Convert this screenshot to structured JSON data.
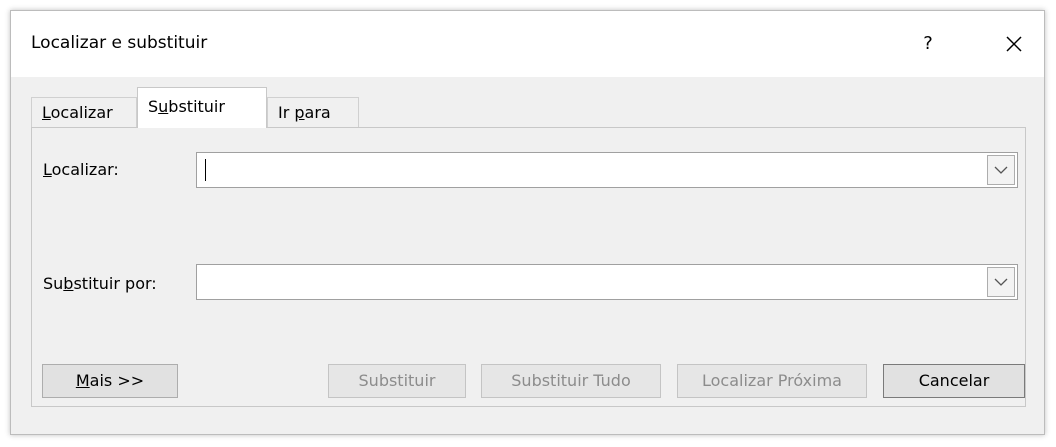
{
  "window": {
    "title": "Localizar e substituir",
    "help_label": "?",
    "close_icon": "close-icon"
  },
  "tabs": [
    {
      "pre": "",
      "ul": "L",
      "post": "ocalizar",
      "active": false
    },
    {
      "pre": "S",
      "ul": "u",
      "post": "bstituir",
      "active": true
    },
    {
      "pre": "Ir ",
      "ul": "p",
      "post": "ara",
      "active": false
    }
  ],
  "fields": {
    "find": {
      "label_ul": "L",
      "label_post": "ocalizar:",
      "value": ""
    },
    "replace": {
      "label_pre": "Su",
      "label_ul": "b",
      "label_post": "stituir por:",
      "value": ""
    }
  },
  "buttons": {
    "more": {
      "ul": "M",
      "post": "ais >>"
    },
    "replace": "Substituir",
    "replace_all": "Substituir Tudo",
    "find_next": "Localizar Próxima",
    "cancel": "Cancelar"
  },
  "colors": {
    "window_bg": "#f0f0f0",
    "titlebar_bg": "#ffffff",
    "disabled_text": "#8c8c8c"
  }
}
